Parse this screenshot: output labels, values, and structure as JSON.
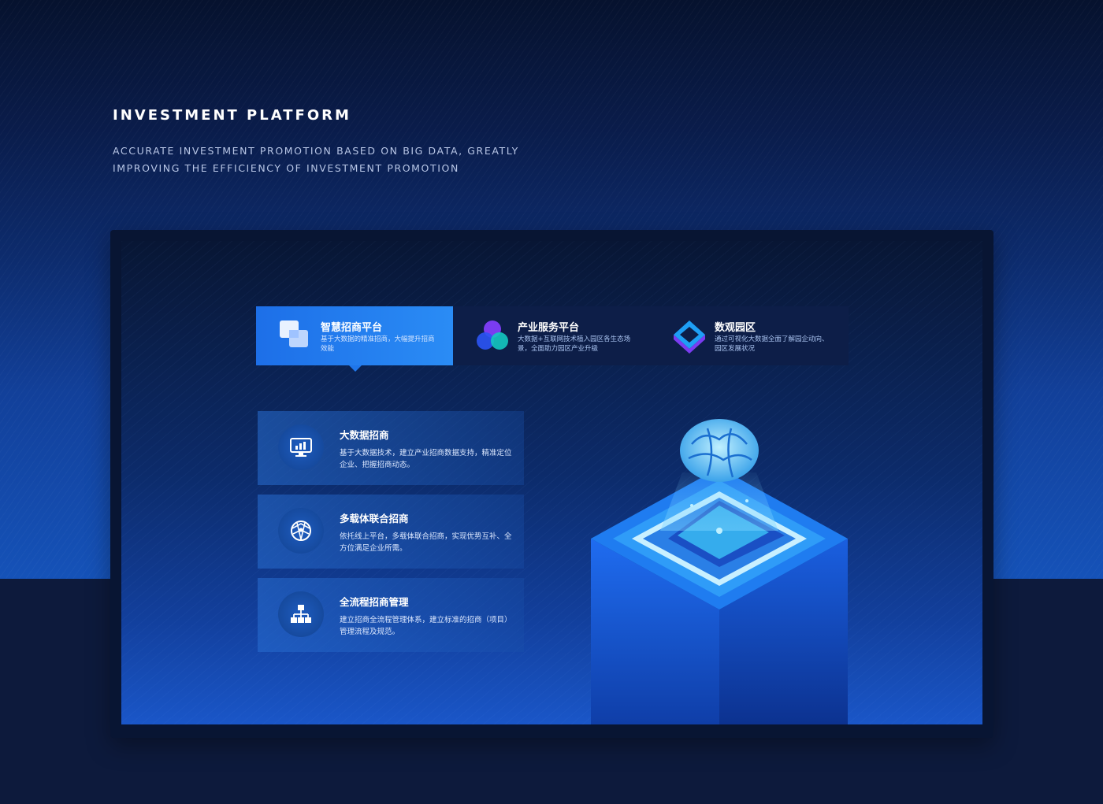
{
  "header": {
    "title": "INVESTMENT PLATFORM",
    "subtitle": "ACCURATE INVESTMENT PROMOTION BASED ON BIG DATA, GREATLY IMPROVING THE EFFICIENCY OF INVESTMENT PROMOTION"
  },
  "tabs": [
    {
      "title": "智慧招商平台",
      "desc": "基于大数据的精准招商，大幅提升招商效能",
      "icon": "stacked-cards-icon",
      "active": true
    },
    {
      "title": "产业服务平台",
      "desc": "大数据+互联网技术植入园区各生态场景，全面助力园区产业升级",
      "icon": "three-circles-icon",
      "active": false
    },
    {
      "title": "数观园区",
      "desc": "通过可视化大数据全面了解园企动向、园区发展状况",
      "icon": "diamond-layers-icon",
      "active": false
    }
  ],
  "features": [
    {
      "title": "大数据招商",
      "desc": "基于大数据技术，建立产业招商数据支持，精准定位企业、把握招商动态。",
      "icon": "monitor-chart-icon"
    },
    {
      "title": "多载体联合招商",
      "desc": "依托线上平台，多载体联合招商，实现优势互补、全方位满足企业所需。",
      "icon": "globe-network-icon"
    },
    {
      "title": "全流程招商管理",
      "desc": "建立招商全流程管理体系，建立标准的招商（项目）管理流程及规范。",
      "icon": "org-chart-icon"
    }
  ],
  "illustration": {
    "icon": "brain-chip-isometric-icon"
  },
  "colors": {
    "accent": "#1f76ea",
    "background": "#081533",
    "text": "#ffffff"
  }
}
